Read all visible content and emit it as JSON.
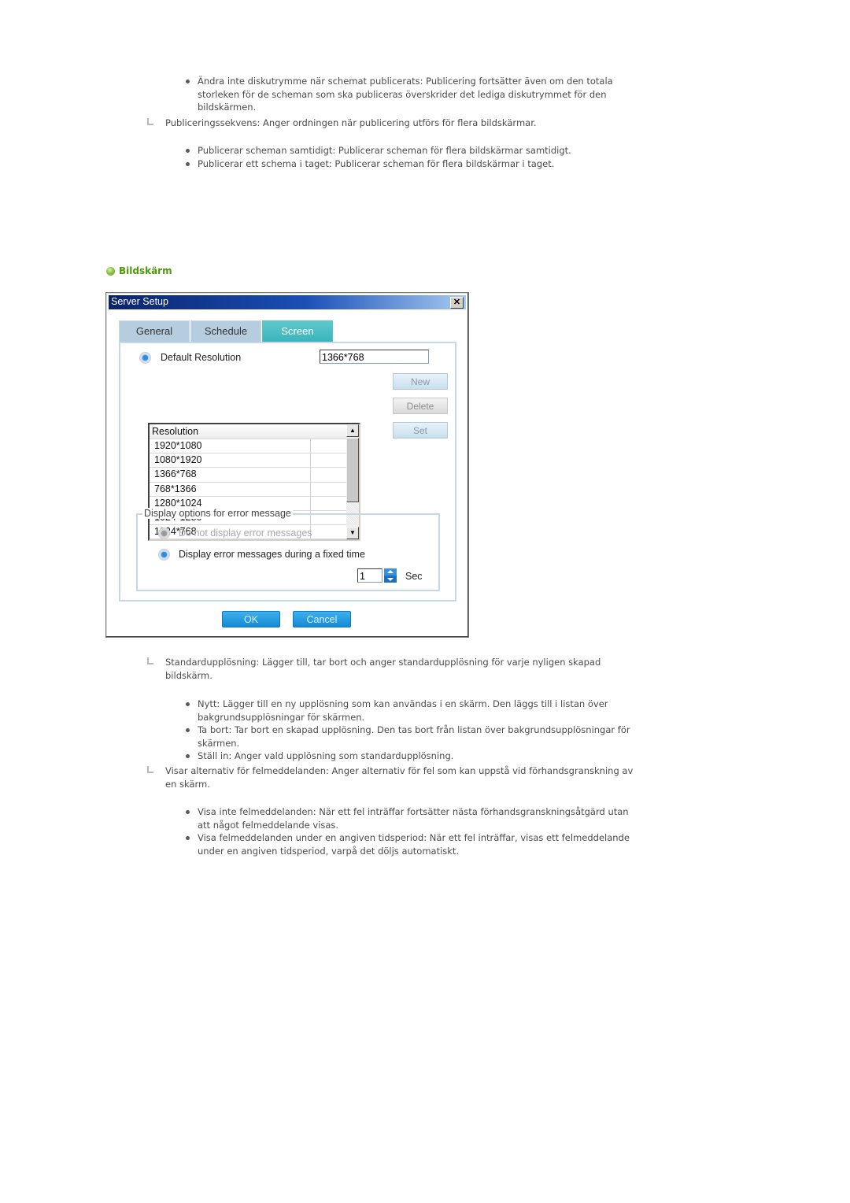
{
  "top_section": {
    "bullets_1": [
      "Ändra inte diskutrymme när schemat publicerats: Publicering fortsätter även om den totala storleken för de scheman som ska publiceras överskrider det lediga diskutrymmet för den bildskärmen."
    ],
    "note_1": "Publiceringssekvens: Anger ordningen när publicering utförs för flera bildskärmar.",
    "bullets_2": [
      "Publicerar scheman samtidigt: Publicerar scheman för flera bildskärmar samtidigt.",
      "Publicerar ett schema i taget: Publicerar scheman för flera bildskärmar i taget."
    ]
  },
  "section": {
    "title": "Bildskärm",
    "icon": "green-ball-icon"
  },
  "dialog": {
    "title": "Server Setup",
    "close_glyph": "✕",
    "tabs": [
      {
        "label": "General",
        "active": false
      },
      {
        "label": "Schedule",
        "active": false
      },
      {
        "label": "Screen",
        "active": true
      }
    ],
    "default_resolution": {
      "label": "Default Resolution",
      "value": "1366*768",
      "selected": true
    },
    "resolution_list": {
      "header": "Resolution",
      "rows": [
        "1920*1080",
        "1080*1920",
        "1366*768",
        "768*1366",
        "1280*1024",
        "1024*1280",
        "1024*768"
      ]
    },
    "side_buttons": {
      "new": "New",
      "delete": "Delete",
      "set": "Set"
    },
    "error_group": {
      "legend": "Display options for error message",
      "option_1": {
        "label": "Do not display error messages",
        "selected": false,
        "disabled": true
      },
      "option_2": {
        "label": "Display error messages during a fixed time",
        "selected": true,
        "disabled": false
      },
      "seconds_value": "1",
      "seconds_unit": "Sec"
    },
    "buttons": {
      "ok": "OK",
      "cancel": "Cancel"
    }
  },
  "bottom_section": {
    "note_1": "Standardupplösning: Lägger till, tar bort och anger standardupplösning för varje nyligen skapad bildskärm.",
    "bullets_1": [
      "Nytt: Lägger till en ny upplösning som kan användas i en skärm. Den läggs till i listan över bakgrundsupplösningar för skärmen.",
      "Ta bort: Tar bort en skapad upplösning. Den tas bort från listan över bakgrundsupplösningar för skärmen.",
      "Ställ in: Anger vald upplösning som standardupplösning."
    ],
    "note_2": "Visar alternativ för felmeddelanden: Anger alternativ för fel som kan uppstå vid förhandsgranskning av en skärm.",
    "bullets_2": [
      "Visa inte felmeddelanden: När ett fel inträffar fortsätter nästa förhandsgranskningsåtgärd utan att något felmeddelande visas.",
      "Visa felmeddelanden under en angiven tidsperiod: När ett fel inträffar, visas ett felmeddelande under en angiven tidsperiod, varpå det döljs automatiskt."
    ]
  }
}
